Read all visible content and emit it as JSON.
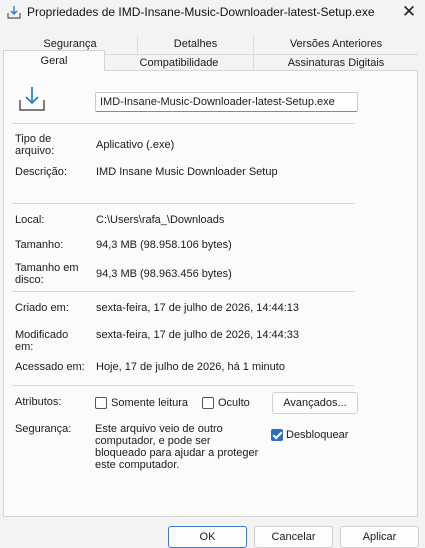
{
  "window": {
    "title": "Propriedades de IMD-Insane-Music-Downloader-latest-Setup.exe",
    "close_glyph": "✕"
  },
  "tabs": {
    "row1": [
      "Segurança",
      "Detalhes",
      "Versões Anteriores"
    ],
    "row2": [
      "Geral",
      "Compatibilidade",
      "Assinaturas Digitais"
    ],
    "active": "Geral"
  },
  "general": {
    "filename": "IMD-Insane-Music-Downloader-latest-Setup.exe",
    "file_icon": "download-file-icon",
    "type_label_1": "Tipo de",
    "type_label_2": "arquivo:",
    "type_value": "Aplicativo (.exe)",
    "description_label": "Descrição:",
    "description_value": "IMD Insane Music Downloader Setup",
    "location_label": "Local:",
    "location_value": "C:\\Users\\rafa_\\Downloads",
    "size_label": "Tamanho:",
    "size_value": "94,3 MB (98.958.106 bytes)",
    "disk_size_label_1": "Tamanho em",
    "disk_size_label_2": "disco:",
    "disk_size_value": "94,3 MB (98.963.456 bytes)",
    "created_label": "Criado em:",
    "created_value": "sexta-feira, 17 de julho de 2026, 14:44:13",
    "modified_label_1": "Modificado",
    "modified_label_2": "em:",
    "modified_value": "sexta-feira, 17 de julho de 2026, 14:44:33",
    "accessed_label": "Acessado em:",
    "accessed_value": "Hoje, 17 de julho de 2026, há 1 minuto",
    "attributes_label": "Atributos:",
    "readonly_label": "Somente leitura",
    "readonly_checked": false,
    "hidden_label": "Oculto",
    "hidden_checked": false,
    "advanced_button": "Avançados...",
    "security_label": "Segurança:",
    "security_text": [
      "Este arquivo veio de outro",
      "computador, e pode ser",
      "bloqueado para ajudar a proteger",
      "este computador."
    ],
    "unblock_label": "Desbloquear",
    "unblock_checked": true
  },
  "footer": {
    "ok": "OK",
    "cancel": "Cancelar",
    "apply": "Aplicar"
  },
  "colors": {
    "accent": "#2f6fbf",
    "icon_blue": "#2a7fd4"
  }
}
